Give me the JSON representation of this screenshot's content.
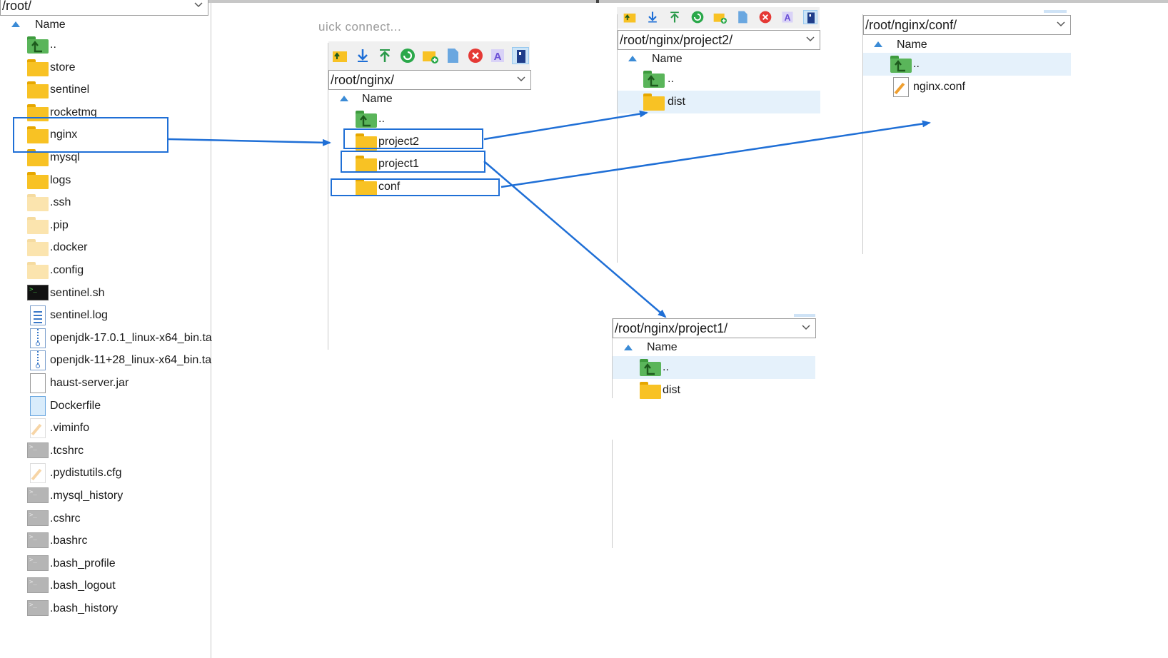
{
  "left_panel": {
    "path": "/root/",
    "header": "Name",
    "items": [
      {
        "name": "..",
        "icon": "parent-folder-icon"
      },
      {
        "name": "store",
        "icon": "folder-icon"
      },
      {
        "name": "sentinel",
        "icon": "folder-icon"
      },
      {
        "name": "rocketmq",
        "icon": "folder-icon"
      },
      {
        "name": "nginx",
        "icon": "folder-icon"
      },
      {
        "name": "mysql",
        "icon": "folder-icon"
      },
      {
        "name": "logs",
        "icon": "folder-icon"
      },
      {
        "name": ".ssh",
        "icon": "hidden-folder-icon"
      },
      {
        "name": ".pip",
        "icon": "hidden-folder-icon"
      },
      {
        "name": ".docker",
        "icon": "hidden-folder-icon"
      },
      {
        "name": ".config",
        "icon": "hidden-folder-icon"
      },
      {
        "name": "sentinel.sh",
        "icon": "terminal-icon"
      },
      {
        "name": "sentinel.log",
        "icon": "text-file-icon"
      },
      {
        "name": "openjdk-17.0.1_linux-x64_bin.ta",
        "icon": "archive-icon"
      },
      {
        "name": "openjdk-11+28_linux-x64_bin.ta",
        "icon": "archive-icon"
      },
      {
        "name": "haust-server.jar",
        "icon": "file-icon"
      },
      {
        "name": "Dockerfile",
        "icon": "file-icon"
      },
      {
        "name": ".viminfo",
        "icon": "hidden-edit-file-icon"
      },
      {
        "name": ".tcshrc",
        "icon": "hidden-terminal-icon"
      },
      {
        "name": ".pydistutils.cfg",
        "icon": "hidden-edit-file-icon"
      },
      {
        "name": ".mysql_history",
        "icon": "hidden-terminal-icon"
      },
      {
        "name": ".cshrc",
        "icon": "hidden-terminal-icon"
      },
      {
        "name": ".bashrc",
        "icon": "hidden-terminal-icon"
      },
      {
        "name": ".bash_profile",
        "icon": "hidden-terminal-icon"
      },
      {
        "name": ".bash_logout",
        "icon": "hidden-terminal-icon"
      },
      {
        "name": ".bash_history",
        "icon": "hidden-terminal-icon"
      }
    ]
  },
  "nginx_panel": {
    "quick_connect": "uick connect...",
    "path": "/root/nginx/",
    "header": "Name",
    "items": [
      {
        "name": "..",
        "icon": "parent-folder-icon"
      },
      {
        "name": "project2",
        "icon": "folder-icon"
      },
      {
        "name": "project1",
        "icon": "folder-icon"
      },
      {
        "name": "conf",
        "icon": "folder-icon"
      }
    ]
  },
  "project2_panel": {
    "path": "/root/nginx/project2/",
    "header": "Name",
    "items": [
      {
        "name": "..",
        "icon": "parent-folder-icon"
      },
      {
        "name": "dist",
        "icon": "folder-icon"
      }
    ]
  },
  "conf_panel": {
    "path": "/root/nginx/conf/",
    "header": "Name",
    "items": [
      {
        "name": "..",
        "icon": "parent-folder-icon"
      },
      {
        "name": "nginx.conf",
        "icon": "edit-file-icon"
      }
    ]
  },
  "project1_panel": {
    "path": "/root/nginx/project1/",
    "header": "Name",
    "items": [
      {
        "name": "..",
        "icon": "parent-folder-icon"
      },
      {
        "name": "dist",
        "icon": "folder-icon"
      }
    ]
  },
  "toolbar_icons": [
    "parent-dir-icon",
    "download-icon",
    "upload-icon",
    "refresh-icon",
    "new-folder-icon",
    "new-file-icon",
    "delete-icon",
    "rename-icon",
    "toggle-panel-icon"
  ],
  "colors": {
    "highlight_box": "#1f6fd6",
    "arrow": "#1f6fd6",
    "selection": "#e5f1fb",
    "folder": "#f8c224"
  }
}
